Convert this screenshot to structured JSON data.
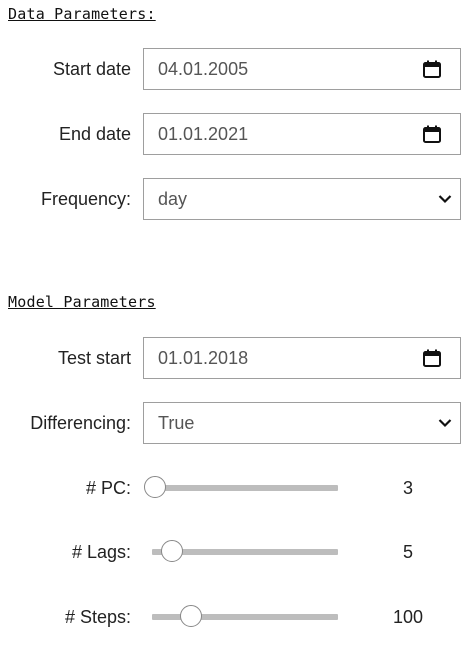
{
  "data_section": {
    "title": "Data Parameters:",
    "start_date": {
      "label": "Start date",
      "value": "04.01.2005",
      "icon": "calendar-icon"
    },
    "end_date": {
      "label": "End date",
      "value": "01.01.2021",
      "icon": "calendar-icon"
    },
    "frequency": {
      "label": "Frequency:",
      "value": "day",
      "icon": "chevron-down-icon"
    }
  },
  "model_section": {
    "title": "Model Parameters",
    "test_start": {
      "label": "Test start",
      "value": "01.01.2018",
      "icon": "calendar-icon"
    },
    "differencing": {
      "label": "Differencing:",
      "value": "True",
      "icon": "chevron-down-icon"
    },
    "pc": {
      "label": "# PC:",
      "value": "3",
      "level": 0.0
    },
    "lags": {
      "label": "# Lags:",
      "value": "5",
      "level": 0.1
    },
    "steps": {
      "label": "# Steps:",
      "value": "100",
      "level": 0.21
    }
  }
}
